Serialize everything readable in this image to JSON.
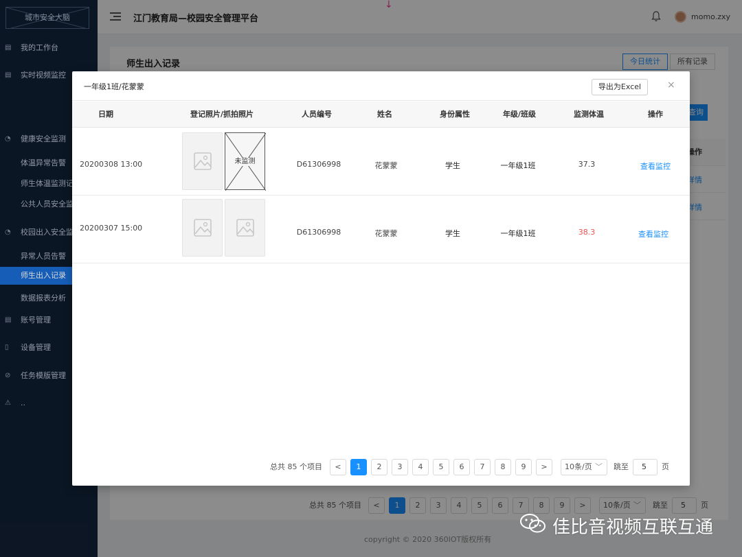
{
  "sidebar": {
    "brand": "城市安全大脑",
    "items": [
      {
        "label": "我的工作台",
        "icon": "grid-icon"
      },
      {
        "label": "实时视频监控",
        "icon": "grid-icon"
      },
      {
        "label": "健康安全监测",
        "icon": "dashboard-icon"
      },
      {
        "label": "体温异常告警",
        "icon": ""
      },
      {
        "label": "师生体温监测记",
        "icon": ""
      },
      {
        "label": "公共人员安全监",
        "icon": ""
      },
      {
        "label": "校园出入安全监",
        "icon": "dashboard-icon"
      },
      {
        "label": "异常人员告警",
        "icon": ""
      },
      {
        "label": "师生出入记录",
        "icon": ""
      },
      {
        "label": "数据报表分析",
        "icon": ""
      },
      {
        "label": "账号管理",
        "icon": "grid-icon"
      },
      {
        "label": "设备管理",
        "icon": "doc-icon"
      },
      {
        "label": "任务模版管理",
        "icon": "check-circle-icon"
      },
      {
        "label": "..",
        "icon": "warning-icon"
      }
    ]
  },
  "header": {
    "title": "江门教育局—校园安全管理平台",
    "username": "momo.zxy"
  },
  "page": {
    "title": "师生出入记录",
    "seg_today": "今日统计",
    "seg_all": "所有记录",
    "query_label": "查询",
    "col_op": "操作",
    "detail_link": "详情",
    "copyright": "copyright © 2020 360IOT版权所有"
  },
  "pagination": {
    "total": "总共 85 个项目",
    "prev": "<",
    "next": ">",
    "pages": [
      "1",
      "2",
      "3",
      "4",
      "5",
      "6",
      "7",
      "8",
      "9"
    ],
    "current": "1",
    "page_size": "10条/页",
    "jump_label": "跳至",
    "jump_value": "5",
    "page_unit": "页"
  },
  "modal": {
    "title": "一年级1班/花蒙蒙",
    "export_label": "导出为Excel",
    "close": "×",
    "columns": [
      "日期",
      "登记照片/抓拍照片",
      "人员编号",
      "姓名",
      "身份属性",
      "年级/班级",
      "监测体温",
      "操作"
    ],
    "rows": [
      {
        "date": "20200308 13:00",
        "capture_status": "未监测",
        "id": "D61306998",
        "name": "花蒙蒙",
        "role": "学生",
        "class": "一年级1班",
        "temp": "37.3",
        "temp_abnormal": false,
        "action": "查看监控"
      },
      {
        "date": "20200307 15:00",
        "capture_status": "",
        "id": "D61306998",
        "name": "花蒙蒙",
        "role": "学生",
        "class": "一年级1班",
        "temp": "38.3",
        "temp_abnormal": true,
        "action": "查看监控"
      }
    ]
  },
  "watermark": {
    "text": "佳比音视频互联互通"
  },
  "colors": {
    "primary": "#1890ff",
    "sidebar_bg": "#0e1a2b",
    "sidebar_active": "#1a6ed8",
    "abnormal_temp": "#f05050"
  }
}
